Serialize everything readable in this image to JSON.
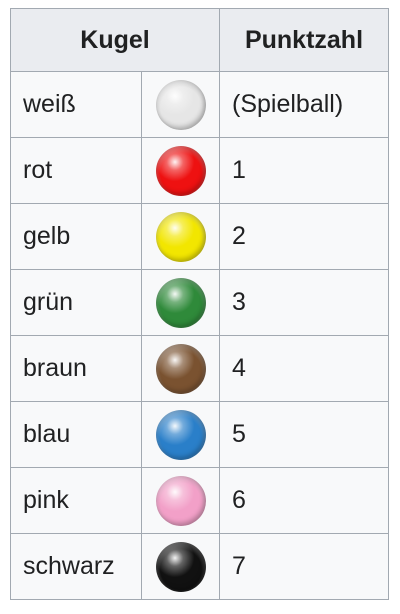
{
  "header": {
    "col_ball": "Kugel",
    "col_points": "Punktzahl"
  },
  "rows": [
    {
      "color_name": "weiß",
      "points": "(Spielball)",
      "color": "#e6e6e6"
    },
    {
      "color_name": "rot",
      "points": "1",
      "color": "#ee1111"
    },
    {
      "color_name": "gelb",
      "points": "2",
      "color": "#f2e600"
    },
    {
      "color_name": "grün",
      "points": "3",
      "color": "#2f8a3a"
    },
    {
      "color_name": "braun",
      "points": "4",
      "color": "#7a5230"
    },
    {
      "color_name": "blau",
      "points": "5",
      "color": "#2a7fc9"
    },
    {
      "color_name": "pink",
      "points": "6",
      "color": "#f2a0c8"
    },
    {
      "color_name": "schwarz",
      "points": "7",
      "color": "#111111"
    }
  ]
}
